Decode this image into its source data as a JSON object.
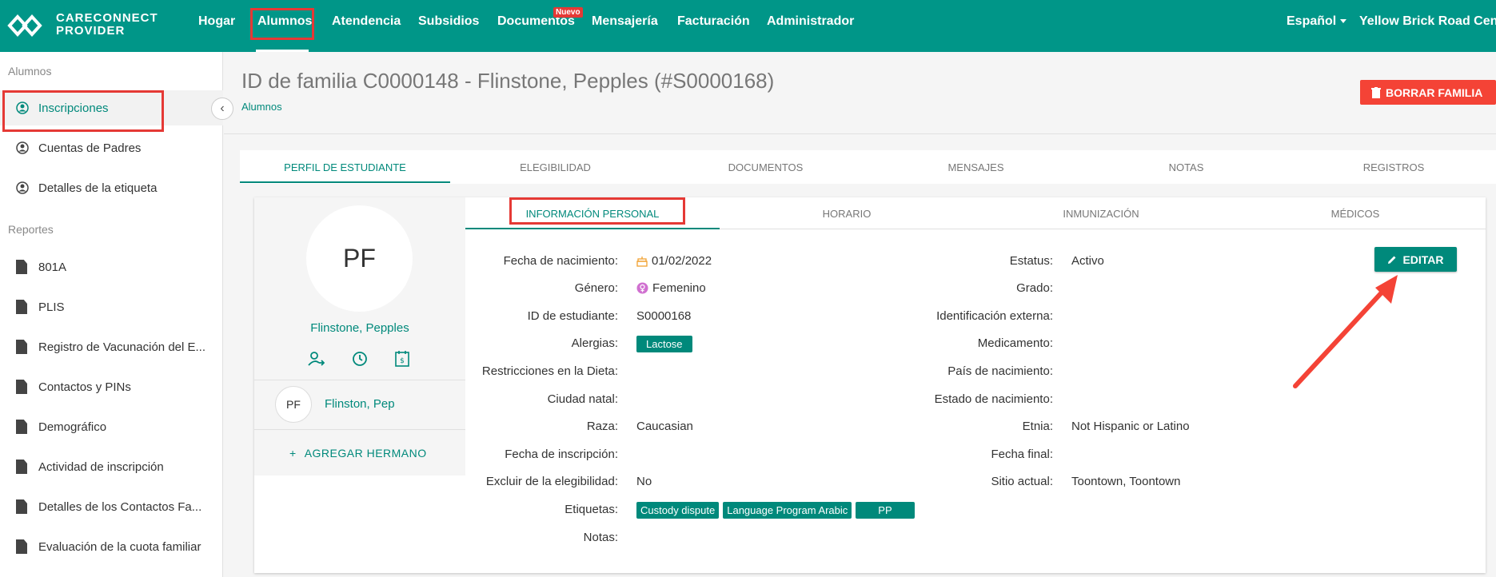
{
  "app": {
    "logo_line1": "CARECONNECT",
    "logo_line2": "PROVIDER"
  },
  "nav": {
    "items": [
      "Hogar",
      "Alumnos",
      "Atendencia",
      "Subsidios",
      "Documentos",
      "Mensajería",
      "Facturación",
      "Administrador"
    ],
    "active": "Alumnos",
    "new_badge": "Nuevo",
    "language": "Español",
    "center": "Yellow Brick Road Center"
  },
  "sidebar": {
    "section1": "Alumnos",
    "items1": [
      "Inscripciones",
      "Cuentas de Padres",
      "Detalles de la etiqueta"
    ],
    "section2": "Reportes",
    "items2": [
      "801A",
      "PLIS",
      "Registro de Vacunación del E...",
      "Contactos y PINs",
      "Demográfico",
      "Actividad de inscripción",
      "Detalles de los Contactos Fa...",
      "Evaluación de la cuota familiar"
    ]
  },
  "header": {
    "title": "ID de familia C0000148 - Flinstone, Pepples (#S0000168)",
    "breadcrumb": "Alumnos",
    "delete_label": "BORRAR FAMILIA"
  },
  "main_tabs": [
    "PERFIL DE ESTUDIANTE",
    "ELEGIBILIDAD",
    "DOCUMENTOS",
    "MENSAJES",
    "NOTAS",
    "REGISTROS"
  ],
  "student": {
    "initials": "PF",
    "name": "Flinstone, Pepples",
    "sibling_initials": "PF",
    "sibling_name": "Flinston, Pep",
    "add_sibling": "AGREGAR HERMANO"
  },
  "sub_tabs": [
    "INFORMACIÓN PERSONAL",
    "HORARIO",
    "INMUNIZACIÓN",
    "MÉDICOS"
  ],
  "edit_label": "EDITAR",
  "fields_left": {
    "birth_label": "Fecha de nacimiento:",
    "birth_value": "01/02/2022",
    "gender_label": "Género:",
    "gender_value": "Femenino",
    "student_id_label": "ID de estudiante:",
    "student_id_value": "S0000168",
    "allergies_label": "Alergias:",
    "allergies_value": "Lactose",
    "diet_label": "Restricciones en la Dieta:",
    "city_label": "Ciudad natal:",
    "race_label": "Raza:",
    "race_value": "Caucasian",
    "enroll_label": "Fecha de inscripción:",
    "exclude_label": "Excluir de la elegibilidad:",
    "exclude_value": "No",
    "tags_label": "Etiquetas:",
    "tags": [
      "Custody dispute",
      "Language Program Arabic",
      "PP"
    ],
    "notes_label": "Notas:"
  },
  "fields_right": {
    "status_label": "Estatus:",
    "status_value": "Activo",
    "grade_label": "Grado:",
    "external_label": "Identificación externa:",
    "medication_label": "Medicamento:",
    "country_label": "País de nacimiento:",
    "state_label": "Estado de nacimiento:",
    "ethnicity_label": "Etnia:",
    "ethnicity_value": "Not Hispanic or Latino",
    "end_label": "Fecha final:",
    "site_label": "Sitio actual:",
    "site_value": "Toontown, Toontown"
  },
  "colors": {
    "primary": "#009688",
    "accent": "#00897b",
    "danger": "#f44336",
    "highlight": "#e53935"
  }
}
